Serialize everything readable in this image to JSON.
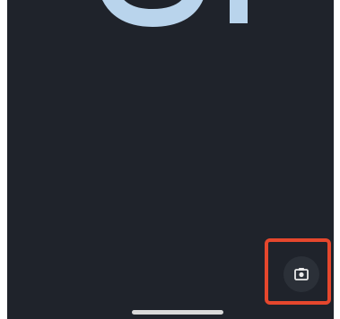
{
  "lock_screen": {
    "background_color": "#1f232b",
    "clock_color": "#b9d4ec",
    "camera_shortcut": {
      "icon": "camera-icon",
      "highlight_color": "#e5472d"
    },
    "home_indicator_color": "#d9d9d9"
  }
}
